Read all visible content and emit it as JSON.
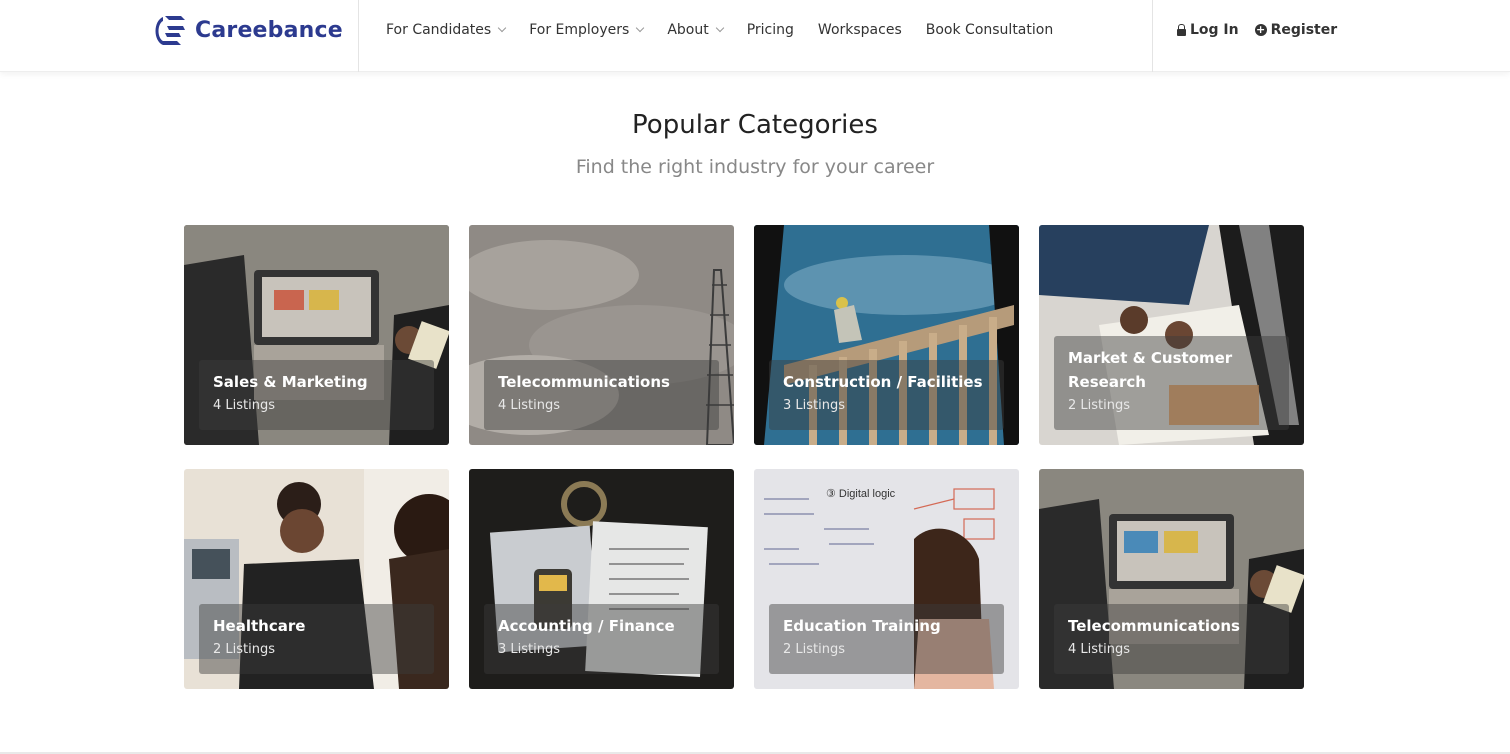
{
  "header": {
    "brand": "Careebance",
    "nav": [
      {
        "label": "For Candidates",
        "dropdown": true
      },
      {
        "label": "For Employers",
        "dropdown": true
      },
      {
        "label": "About",
        "dropdown": true
      },
      {
        "label": "Pricing",
        "dropdown": false
      },
      {
        "label": "Workspaces",
        "dropdown": false
      },
      {
        "label": "Book Consultation",
        "dropdown": false
      }
    ],
    "login": "Log In",
    "register": "Register"
  },
  "section": {
    "title": "Popular Categories",
    "subtitle": "Find the right industry for your career"
  },
  "categories": [
    {
      "name": "Sales & Marketing",
      "count": "4 Listings"
    },
    {
      "name": "Telecommunications",
      "count": "4 Listings"
    },
    {
      "name": "Construction / Facilities",
      "count": "3 Listings"
    },
    {
      "name": "Market & Customer Research",
      "count": "2 Listings"
    },
    {
      "name": "Healthcare",
      "count": "2 Listings"
    },
    {
      "name": "Accounting / Finance",
      "count": "3 Listings"
    },
    {
      "name": "Education Training",
      "count": "2 Listings"
    },
    {
      "name": "Telecommunications",
      "count": "4 Listings"
    }
  ],
  "colors": {
    "brand": "#2c3a8f",
    "text": "#333333",
    "muted": "#888888"
  }
}
